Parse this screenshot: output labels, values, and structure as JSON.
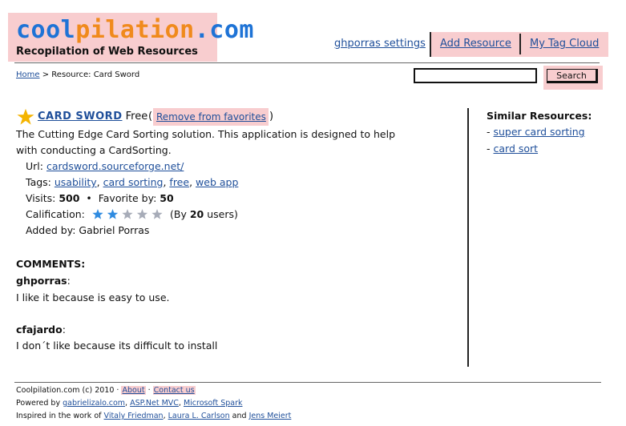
{
  "header": {
    "logo_part1": "cool",
    "logo_part2": "pilation",
    "logo_part3": ".com",
    "tagline": "Recopilation of Web Resources",
    "settings_link": "ghporras settings",
    "add_resource": "Add Resource",
    "tag_cloud": "My Tag Cloud"
  },
  "breadcrumb": {
    "home": "Home",
    "separator": ">",
    "current": "Resource: Card Sword"
  },
  "search": {
    "value": "",
    "button_label": "Search"
  },
  "resource": {
    "name": "CARD SWORD",
    "price": "Free",
    "paren_open": "(",
    "remove_favorite": "Remove from favorites",
    "paren_close": ")",
    "description": "The Cutting Edge Card Sorting solution. This application is designed to help with conducting a CardSorting.",
    "url_label": "Url:",
    "url": "cardsword.sourceforge.net/",
    "tags_label": "Tags:",
    "tags": [
      "usability",
      "card sorting",
      "free",
      "web app"
    ],
    "visits_label": "Visits:",
    "visits": "500",
    "bullet": "•",
    "favorite_label": "Favorite by:",
    "favorite_count": "50",
    "calification_label": "Calification:",
    "rating": 2,
    "rating_max": 5,
    "by_open": "(By",
    "by_count": "20",
    "by_close": "users)",
    "added_by": "Added by: Gabriel Porras"
  },
  "comments": {
    "heading": "COMMENTS:",
    "items": [
      {
        "user": "ghporras",
        "text": "I like it because is easy to use."
      },
      {
        "user": "cfajardo",
        "text": "I don´t like because its difficult to install"
      }
    ]
  },
  "sidebar": {
    "heading": "Similar Resources:",
    "dash": "-",
    "items": [
      "super card sorting",
      "card sort"
    ]
  },
  "footer": {
    "copyright": "Coolpilation.com (c) 2010",
    "dot": "·",
    "about": "About",
    "contact": "Contact us",
    "powered_by": "Powered by",
    "powered": [
      "gabrielizalo.com",
      "ASP.Net MVC",
      "Microsoft Spark"
    ],
    "inspired_by": "Inspired in the work of",
    "inspired": [
      "Vitaly Friedman",
      "Laura L. Carlson",
      "Jens Meiert"
    ],
    "and": "and"
  },
  "colors": {
    "highlight": "#f8cdcf",
    "logo_blue": "#1e73d6",
    "logo_orange": "#f08a1c",
    "star_on": "#2f8be0",
    "star_off": "#a7acb8",
    "fav_star": "#f4b400",
    "link": "#1f4f9a"
  }
}
